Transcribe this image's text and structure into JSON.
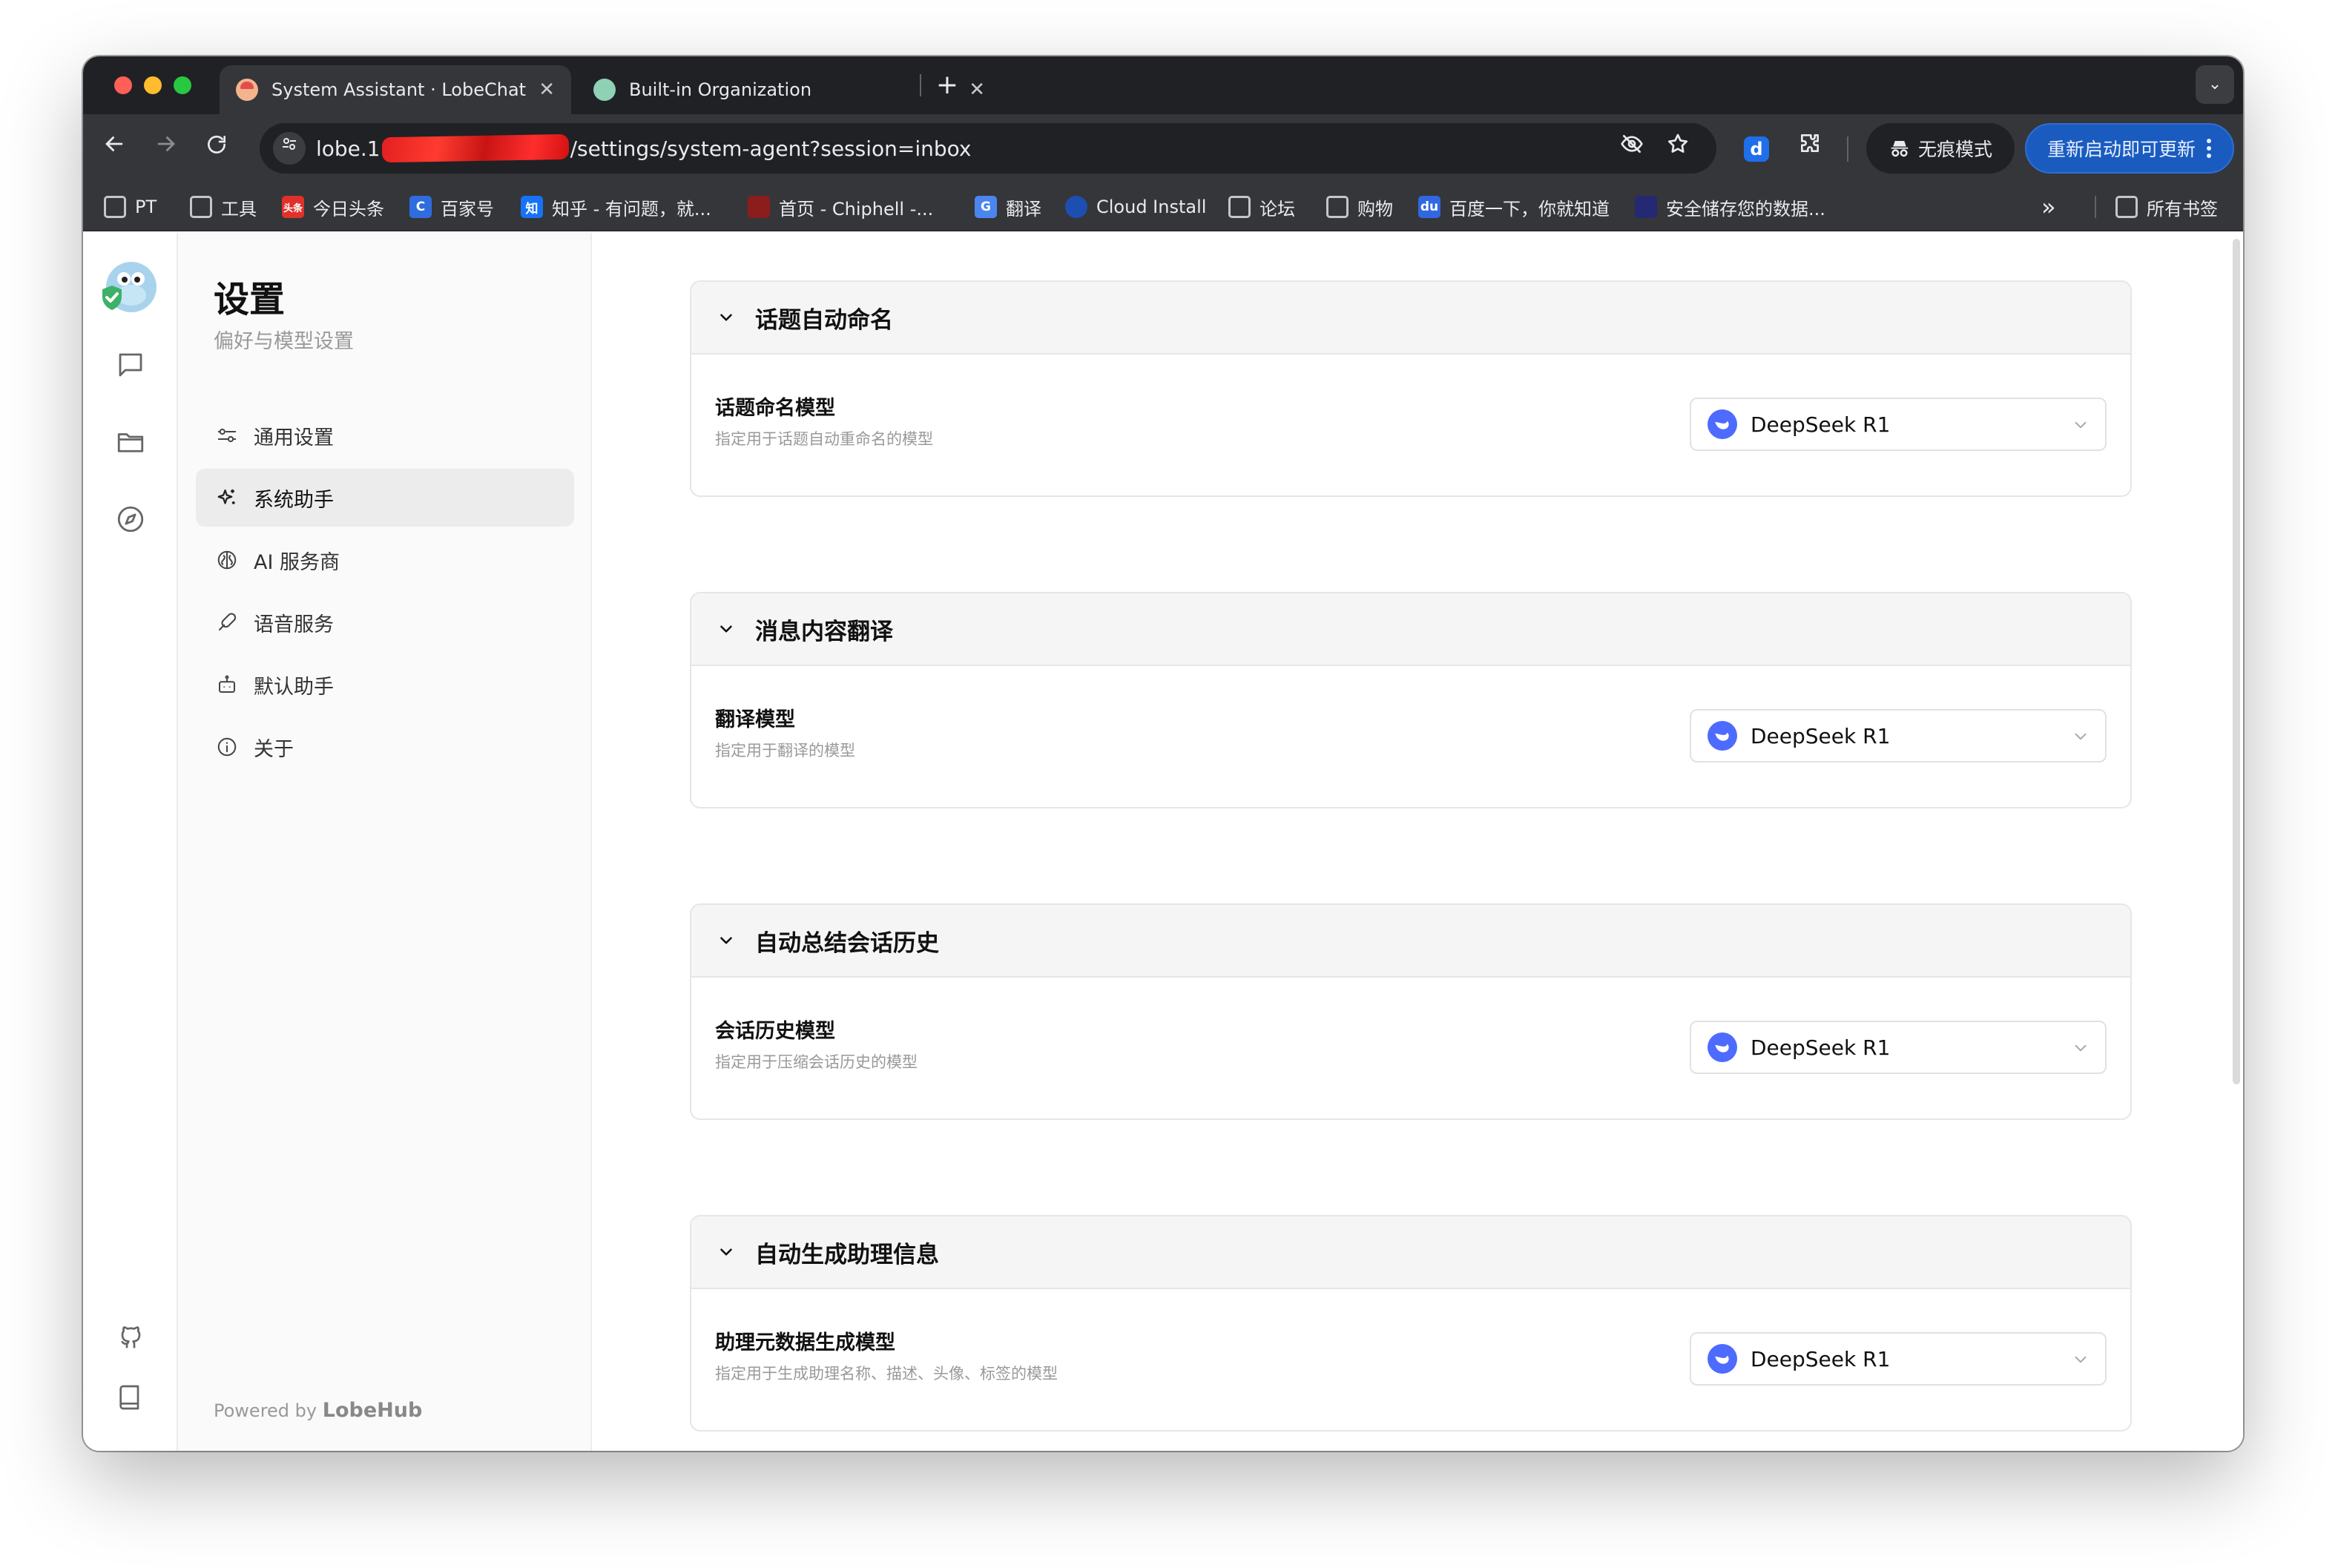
{
  "browser": {
    "tabs": [
      {
        "title": "System Assistant · LobeChat",
        "active": true
      },
      {
        "title": "Built-in Organization",
        "active": false
      }
    ],
    "tab_close_glyph": "✕",
    "new_tab_glyph": "+",
    "tab_menu_glyph": "⌄",
    "url": {
      "prefix": "lobe.1",
      "suffix": "/settings/system-agent?session=inbox"
    },
    "incognito_label": "无痕模式",
    "relaunch_label": "重新启动即可更新",
    "bookmarks": [
      {
        "label": "PT",
        "icon": "folder"
      },
      {
        "label": "工具",
        "icon": "folder"
      },
      {
        "label": "今日头条",
        "icon": "toutiao",
        "glyph": "头条"
      },
      {
        "label": "百家号",
        "icon": "baijia",
        "glyph": "C"
      },
      {
        "label": "知乎 - 有问题，就...",
        "icon": "zhihu",
        "glyph": "知"
      },
      {
        "label": "首页 - Chiphell -...",
        "icon": "chiphell",
        "glyph": ""
      },
      {
        "label": "翻译",
        "icon": "translate",
        "glyph": "G"
      },
      {
        "label": "Cloud Install",
        "icon": "cloud",
        "glyph": ""
      },
      {
        "label": "论坛",
        "icon": "folder"
      },
      {
        "label": "购物",
        "icon": "folder"
      },
      {
        "label": "百度一下，你就知道",
        "icon": "baidu",
        "glyph": "du"
      },
      {
        "label": "安全储存您的数据...",
        "icon": "lock",
        "glyph": ""
      }
    ],
    "bookmarks_more_glyph": "»",
    "all_bookmarks_label": "所有书签"
  },
  "sidebar": {
    "title": "设置",
    "subtitle": "偏好与模型设置",
    "items": [
      {
        "label": "通用设置",
        "icon": "sliders-icon",
        "active": false
      },
      {
        "label": "系统助手",
        "icon": "sparkles-icon",
        "active": true
      },
      {
        "label": "AI 服务商",
        "icon": "brain-icon",
        "active": false
      },
      {
        "label": "语音服务",
        "icon": "mic-icon",
        "active": false
      },
      {
        "label": "默认助手",
        "icon": "bot-icon",
        "active": false
      },
      {
        "label": "关于",
        "icon": "info-icon",
        "active": false
      }
    ],
    "powered_prefix": "Powered by",
    "powered_brand": "LobeHub"
  },
  "sections": [
    {
      "title": "话题自动命名",
      "label": "话题命名模型",
      "desc": "指定用于话题自动重命名的模型",
      "model": "DeepSeek R1"
    },
    {
      "title": "消息内容翻译",
      "label": "翻译模型",
      "desc": "指定用于翻译的模型",
      "model": "DeepSeek R1"
    },
    {
      "title": "自动总结会话历史",
      "label": "会话历史模型",
      "desc": "指定用于压缩会话历史的模型",
      "model": "DeepSeek R1"
    },
    {
      "title": "自动生成助理信息",
      "label": "助理元数据生成模型",
      "desc": "指定用于生成助理名称、描述、头像、标签的模型",
      "model": "DeepSeek R1"
    }
  ],
  "colors": {
    "accent": "#4d6bfe",
    "relaunch": "#1a5bbf"
  }
}
